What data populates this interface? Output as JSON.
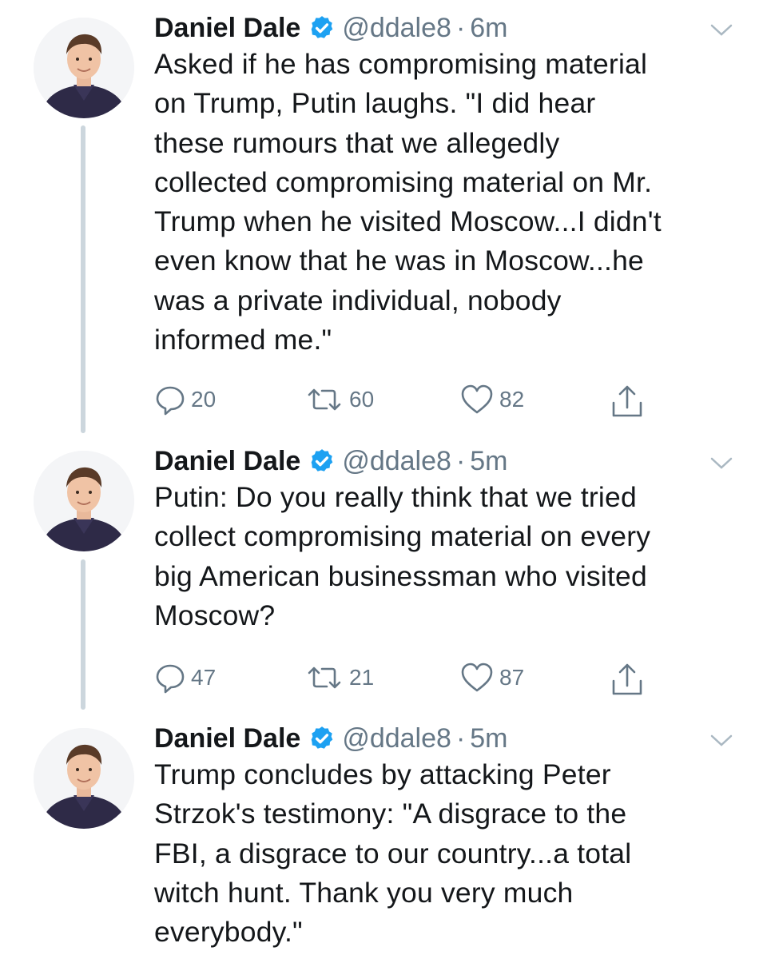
{
  "tweets": [
    {
      "name": "Daniel Dale",
      "handle": "@ddale8",
      "separator": "·",
      "time": "6m",
      "text": "Asked if he has compromising material\non Trump, Putin laughs. \"I did hear\nthese rumours that we allegedly\ncollected compromising material on Mr.\nTrump when he visited Moscow...I didn't\neven know that he was in Moscow...he\nwas a private individual, nobody\ninformed me.\"",
      "replies": "20",
      "retweets": "60",
      "likes": "82"
    },
    {
      "name": "Daniel Dale",
      "handle": "@ddale8",
      "separator": "·",
      "time": "5m",
      "text": "Putin: Do you really think that we tried\ncollect compromising material on every\nbig American businessman who visited\nMoscow?",
      "replies": "47",
      "retweets": "21",
      "likes": "87"
    },
    {
      "name": "Daniel Dale",
      "handle": "@ddale8",
      "separator": "·",
      "time": "5m",
      "text": "Trump concludes by attacking Peter\nStrzok's testimony: \"A disgrace to the\nFBI, a disgrace to our country...a total\nwitch hunt. Thank you very much\neverybody.\""
    }
  ],
  "colors": {
    "verified": "#1da1f2",
    "secondary_text": "#657786",
    "thread_line": "#ccd6dd"
  },
  "icons": [
    "verified-badge-icon",
    "chevron-down-icon",
    "reply-icon",
    "retweet-icon",
    "like-icon",
    "share-icon"
  ]
}
